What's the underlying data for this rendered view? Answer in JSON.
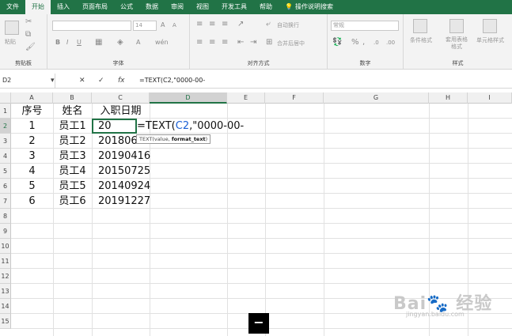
{
  "menu": [
    "文件",
    "开始",
    "插入",
    "页面布局",
    "公式",
    "数据",
    "审阅",
    "视图",
    "开发工具",
    "帮助",
    "操作说明搜索"
  ],
  "ribbon": {
    "groups": [
      "剪贴板",
      "字体",
      "对齐方式",
      "数字",
      "样式"
    ],
    "paste_label": "粘贴",
    "font_size": "14",
    "wrap_label": "自动换行",
    "merge_label": "合并后居中",
    "number_format": "常规",
    "cond_format": "条件格式",
    "table_format": "套用表格格式",
    "cell_style": "单元格样式"
  },
  "formula_bar": {
    "name_box": "D2",
    "fx": "fx",
    "formula": "=TEXT(C2,\"0000-00-"
  },
  "columns": [
    "A",
    "B",
    "C",
    "D",
    "E",
    "F",
    "G",
    "H",
    "I"
  ],
  "rows": [
    "1",
    "2",
    "3",
    "4",
    "5",
    "6",
    "7",
    "8",
    "9",
    "10",
    "11",
    "12",
    "13",
    "14",
    "15"
  ],
  "table": {
    "headers": [
      "序号",
      "姓名",
      "入职日期"
    ],
    "rows": [
      [
        "1",
        "员工1",
        "20"
      ],
      [
        "2",
        "员工2",
        "20180615"
      ],
      [
        "3",
        "员工3",
        "20190416"
      ],
      [
        "4",
        "员工4",
        "20150725"
      ],
      [
        "5",
        "员工5",
        "20140924"
      ],
      [
        "6",
        "员工6",
        "20191227"
      ]
    ]
  },
  "active_cell": {
    "before_ref": "=TEXT(",
    "ref": "C2",
    "after_ref": ",\"0000-00-"
  },
  "tooltip": {
    "fn": "TEXT(value, ",
    "arg": "format_text",
    ")": ")",
    "close": ")"
  },
  "minus_label": "−",
  "watermark": {
    "main": "Bai du 经验",
    "sub": "jingyan.baidu.com"
  },
  "colors": {
    "accent": "#217346",
    "ref": "#1a5fd4"
  }
}
